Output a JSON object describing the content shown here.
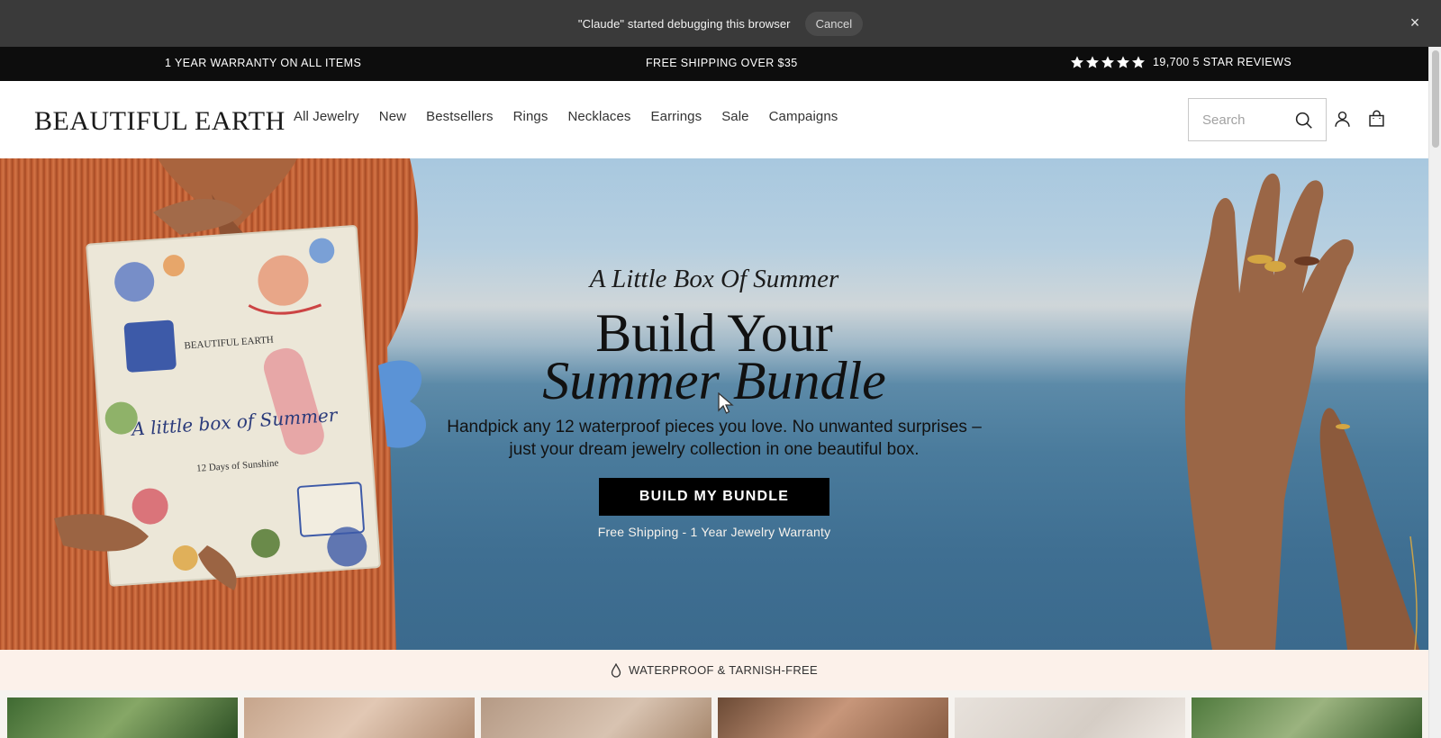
{
  "debug_bar": {
    "message": "\"Claude\" started debugging this browser",
    "cancel_label": "Cancel",
    "close_glyph": "×"
  },
  "announcement": {
    "left": "1 YEAR WARRANTY ON ALL ITEMS",
    "center": "FREE SHIPPING OVER $35",
    "right": "19,700 5 STAR REVIEWS",
    "stars": 5
  },
  "header": {
    "logo": "BEAUTIFUL EARTH",
    "nav": [
      {
        "label": "All Jewelry"
      },
      {
        "label": "New"
      },
      {
        "label": "Bestsellers"
      },
      {
        "label": "Rings"
      },
      {
        "label": "Necklaces"
      },
      {
        "label": "Earrings"
      },
      {
        "label": "Sale"
      },
      {
        "label": "Campaigns"
      }
    ],
    "search": {
      "placeholder": "Search",
      "value": ""
    },
    "icons": [
      "search-icon",
      "user-icon",
      "shopping-bag-icon"
    ]
  },
  "hero": {
    "kicker": "A Little Box Of Summer",
    "title_line1": "Build Your",
    "title_line2": "Summer Bundle",
    "description": "Handpick any 12 waterproof pieces you love. No unwanted surprises – just your dream jewelry collection in one beautiful box.",
    "cta_label": "BUILD MY BUNDLE",
    "sub_text": "Free Shipping - 1 Year Jewelry Warranty",
    "box_art": {
      "brand": "BEAUTIFUL EARTH",
      "script_title": "A little box of Summer",
      "caption": "12 Days of Sunshine"
    }
  },
  "feature_strip": {
    "icon": "water-drop-icon",
    "label": "WATERPROOF & TARNISH-FREE"
  },
  "colors": {
    "debug_bar_bg": "#3a3a3a",
    "announce_bg": "#0d0d0d",
    "cta_bg": "#000000",
    "feature_bg": "#fcf1ea",
    "sea": "#3f6f92"
  }
}
